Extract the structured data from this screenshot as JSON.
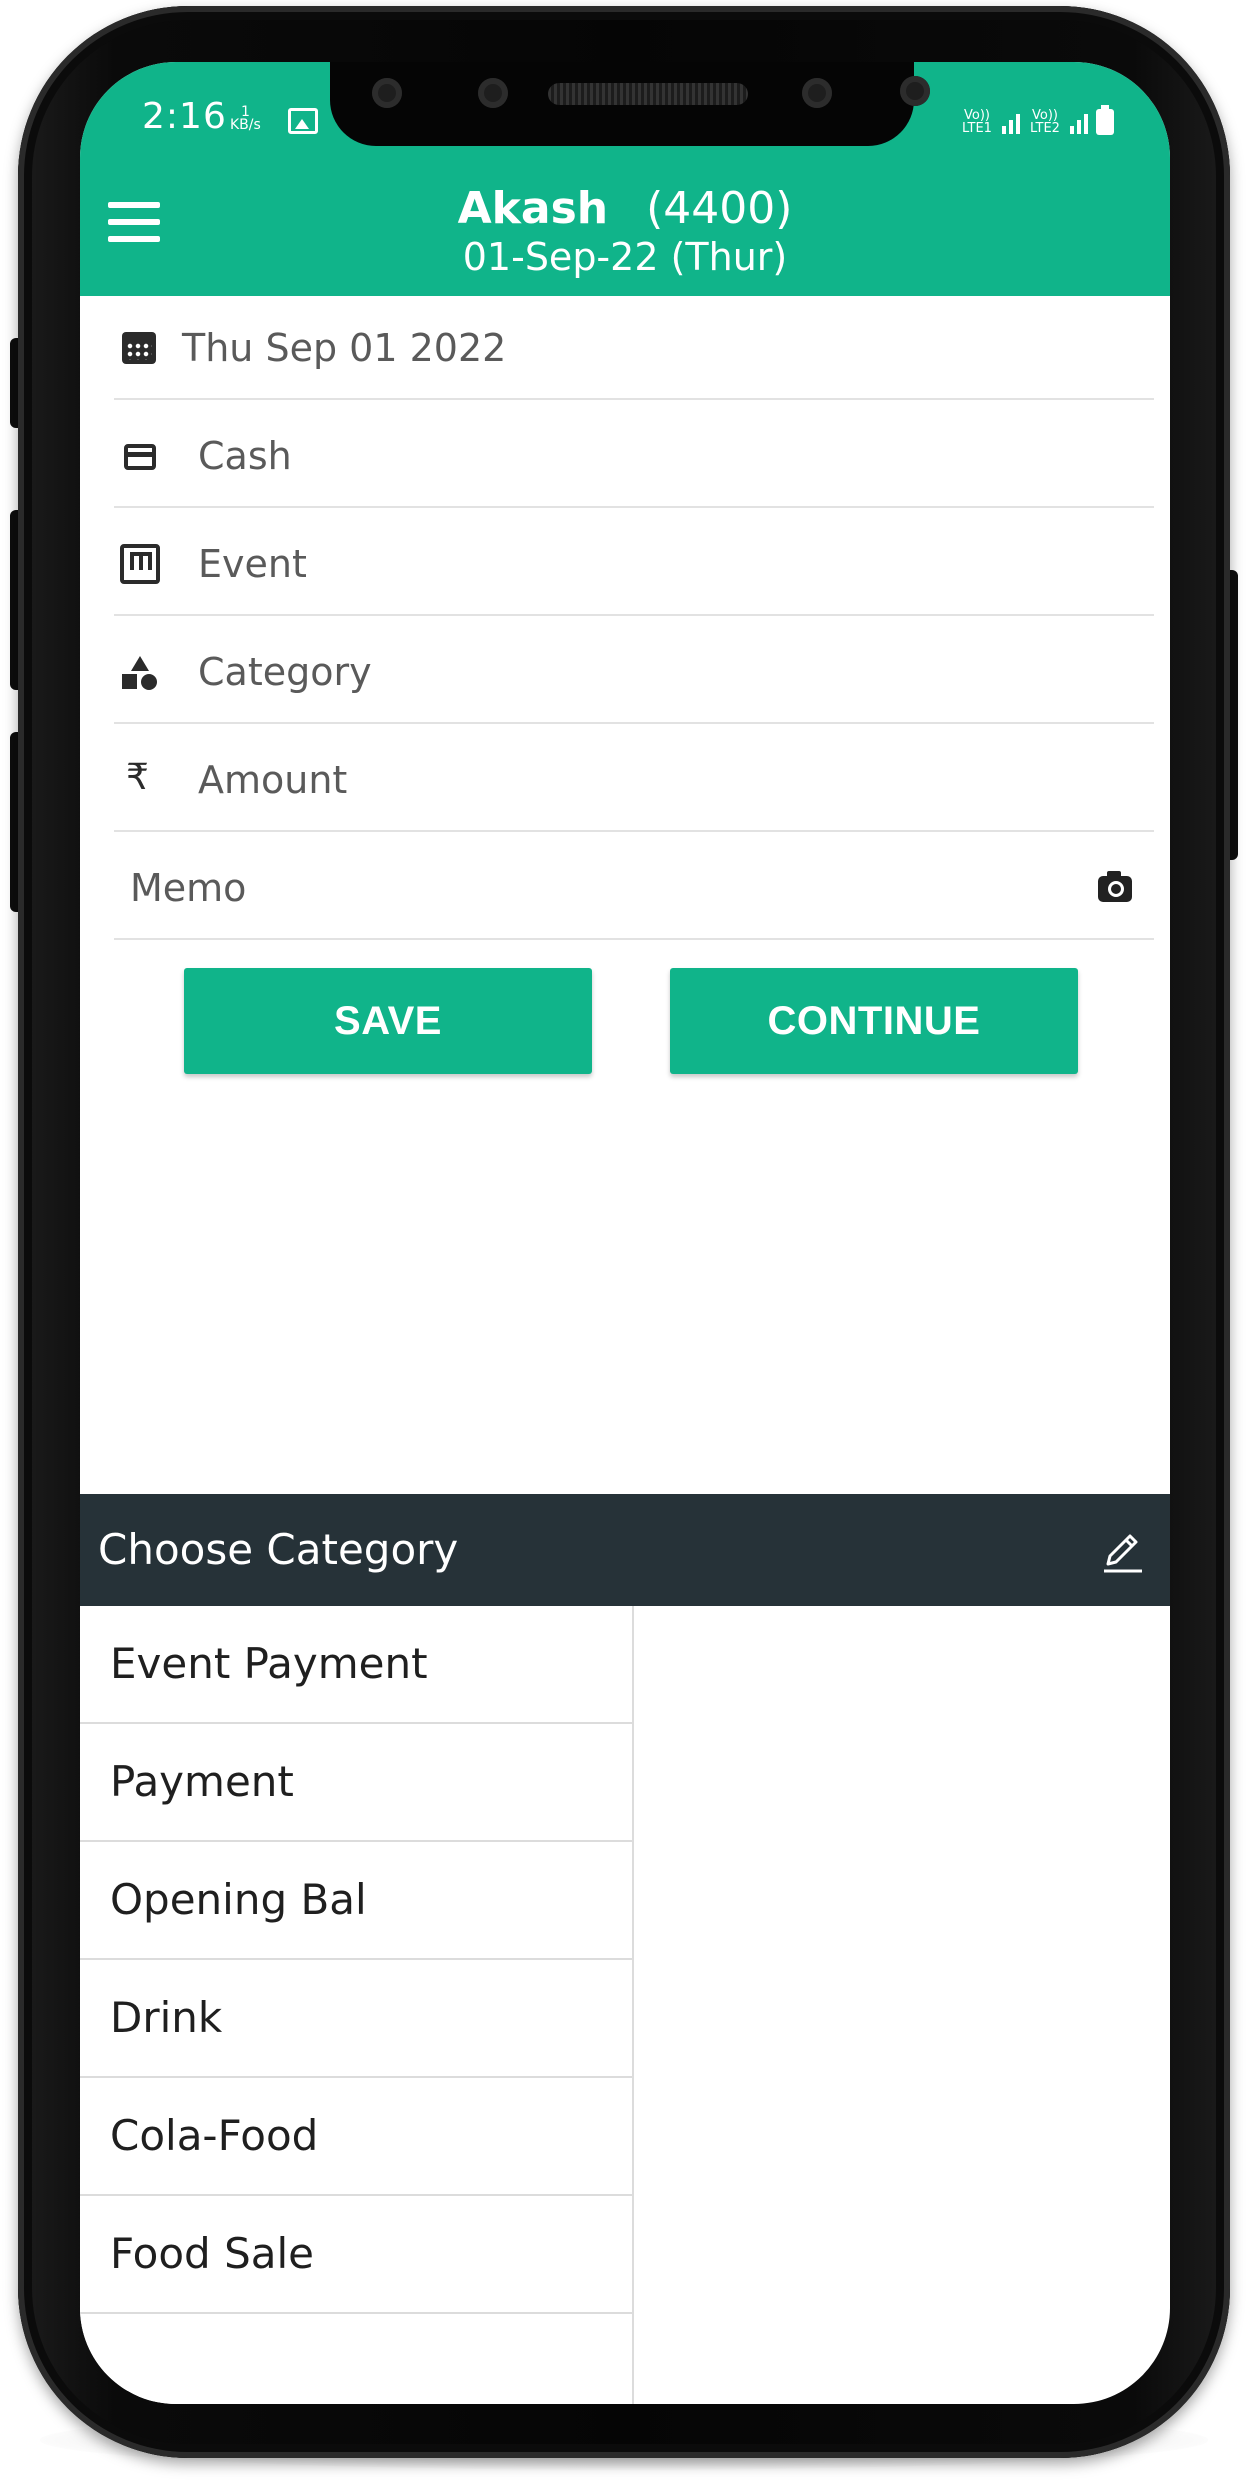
{
  "status_bar": {
    "time": "2:16",
    "net_speed_value": "1",
    "net_speed_unit": "KB/s",
    "sim1_label": "Vo)) LTE1",
    "sim2_label": "Vo)) LTE2"
  },
  "header": {
    "name": "Akash",
    "count": "(4400)",
    "date": "01-Sep-22 (Thur)"
  },
  "form": {
    "date_value": "Thu Sep 01 2022",
    "account_value": "Cash",
    "event_placeholder": "Event",
    "category_placeholder": "Category",
    "amount_symbol": "₹",
    "amount_placeholder": "Amount",
    "memo_placeholder": "Memo"
  },
  "buttons": {
    "save": "SAVE",
    "continue": "CONTINUE"
  },
  "category_sheet": {
    "title": "Choose Category",
    "items": [
      "Event Payment",
      "Payment",
      "Opening Bal",
      "Drink",
      "Cola-Food",
      "Food Sale"
    ]
  },
  "colors": {
    "primary": "#10b48a",
    "sheet_header": "#263238"
  }
}
